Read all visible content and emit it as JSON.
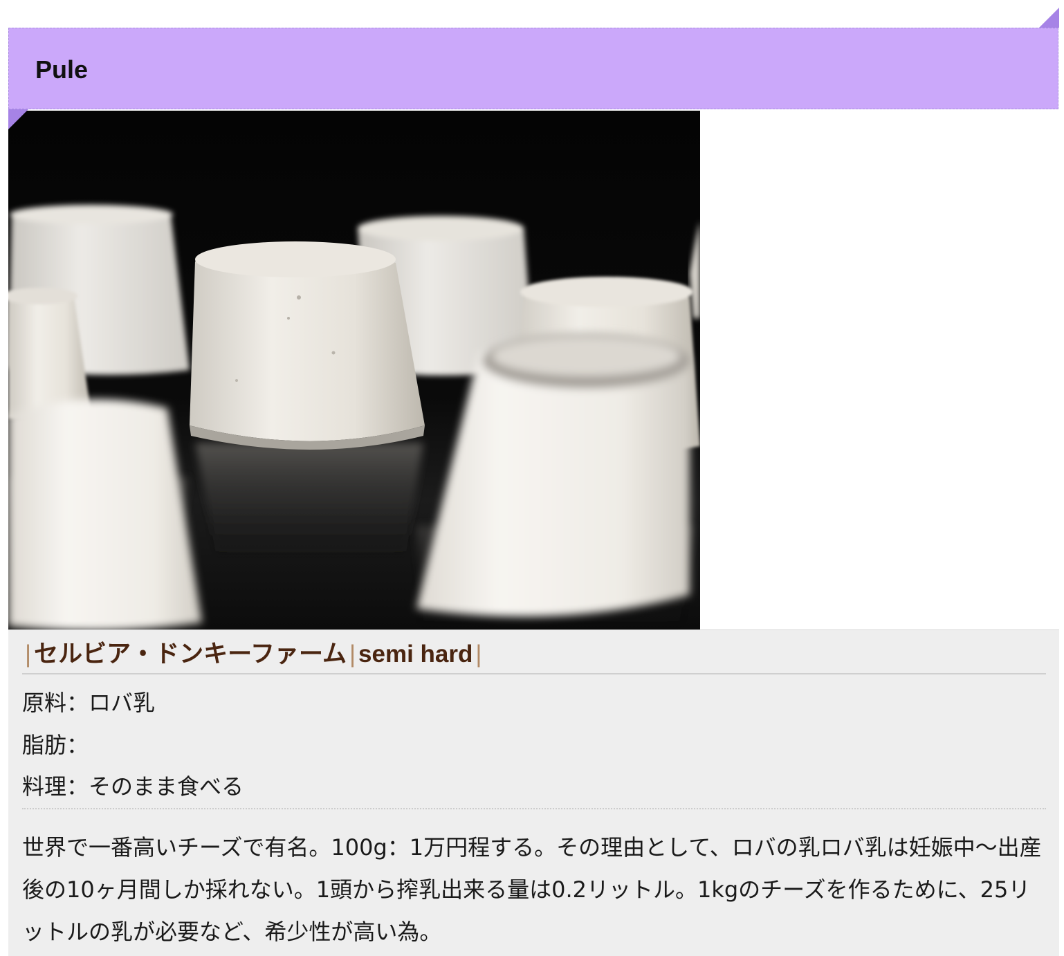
{
  "header": {
    "title": "Pule",
    "ribbon_color": "#cba8fa",
    "fold_color": "#a683e6"
  },
  "photo": {
    "subject": "white fresh cheese rounds on black glossy surface",
    "background_color": "#060606"
  },
  "info": {
    "producer_line": {
      "bar_left": "|",
      "producer": "セルビア・ドンキーファーム",
      "bar_mid": "|",
      "type": "semi hard",
      "bar_right": "|"
    },
    "specs": {
      "ingredient_label": "原料：",
      "ingredient_value": "ロバ乳",
      "fat_label": "脂肪：",
      "fat_value": "",
      "dish_label": "料理：",
      "dish_value": "そのまま食べる"
    },
    "description": "世界で一番高いチーズで有名。100g：1万円程する。その理由として、ロバの乳ロバ乳は妊娠中〜出産後の10ヶ月間しか採れない。1頭から搾乳出来る量は0.2リットル。1kgのチーズを作るために、25リットルの乳が必要など、希少性が高い為。"
  },
  "colors": {
    "panel_bg": "#eeeeee",
    "meta_text": "#4a2510"
  }
}
